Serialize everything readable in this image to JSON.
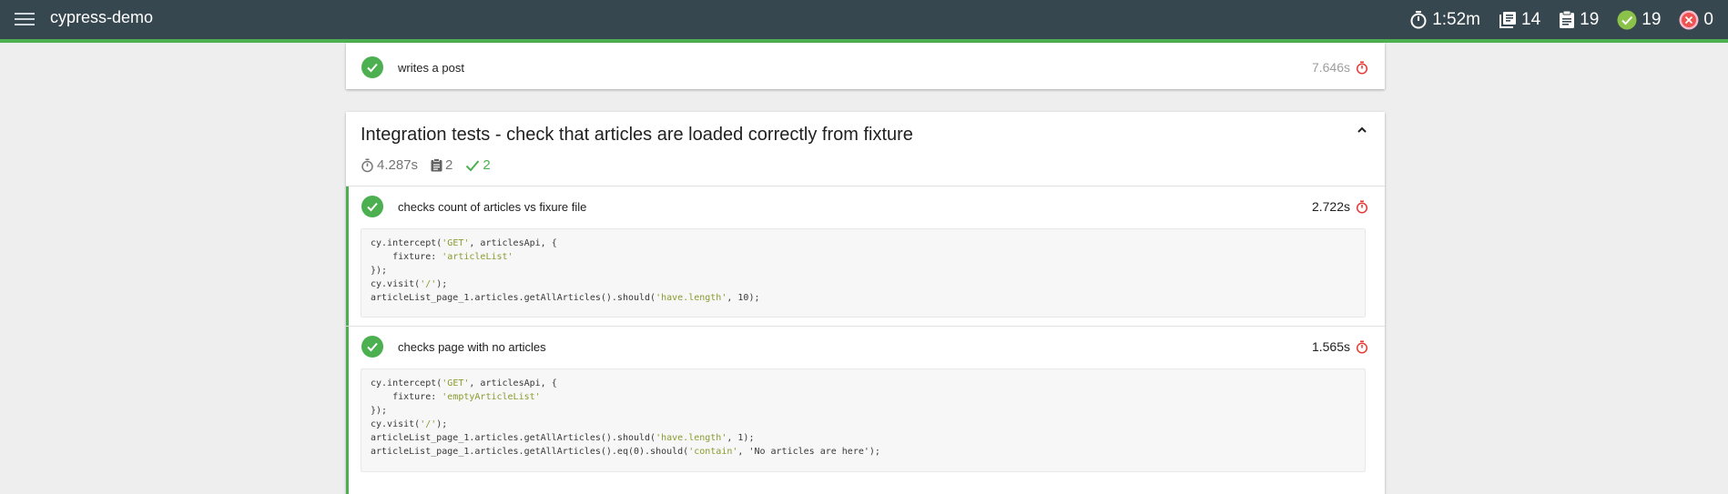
{
  "app": {
    "title": "cypress-demo"
  },
  "stats": {
    "duration": "1:52m",
    "suites": "14",
    "tests": "19",
    "passed": "19",
    "failed": "0"
  },
  "colors": {
    "pass": "#4caf50",
    "fail": "#f44336",
    "nav": "#37474f"
  },
  "top_test": {
    "title": "writes a post",
    "duration": "7.646s"
  },
  "suite": {
    "title": "Integration tests - check that articles are loaded correctly from fixture",
    "duration": "4.287s",
    "tests": "2",
    "passed": "2",
    "tests_list": [
      {
        "title": "checks count of articles vs fixure file",
        "duration": "2.722s",
        "code": [
          [
            "cy.intercept(",
            "'GET'",
            ", articlesApi, {"
          ],
          [
            "    fixture: ",
            "'articleList'",
            ""
          ],
          [
            "});",
            "",
            ""
          ],
          [
            "cy.visit(",
            "'/'",
            ");"
          ],
          [
            "articleList_page_1.articles.getAllArticles().should(",
            "'have.length'",
            ", 10);"
          ]
        ]
      },
      {
        "title": "checks page with no articles",
        "duration": "1.565s",
        "code": [
          [
            "cy.intercept(",
            "'GET'",
            ", articlesApi, {"
          ],
          [
            "    fixture: ",
            "'emptyArticleList'",
            ""
          ],
          [
            "});",
            "",
            ""
          ],
          [
            "cy.visit(",
            "'/'",
            ");"
          ],
          [
            "articleList_page_1.articles.getAllArticles().should(",
            "'have.length'",
            ", 1);"
          ],
          [
            "articleList_page_1.articles.getAllArticles().eq(0).should(",
            "'contain'",
            ", 'No articles are here');"
          ]
        ]
      }
    ]
  }
}
